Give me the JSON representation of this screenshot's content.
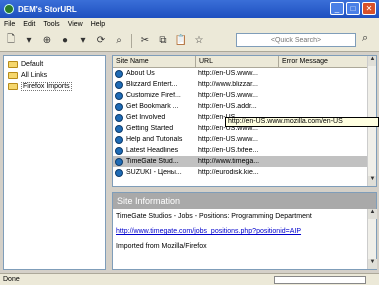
{
  "window": {
    "title": "DEM's StorURL"
  },
  "menubar": [
    "File",
    "Edit",
    "Tools",
    "View",
    "Help"
  ],
  "toolbar": {
    "quick_search_placeholder": "<Quick Search>"
  },
  "tree": {
    "items": [
      {
        "label": "Default",
        "selected": false
      },
      {
        "label": "All Links",
        "selected": false
      },
      {
        "label": "Firefox Imports",
        "selected": true
      }
    ]
  },
  "list": {
    "columns": [
      "Site Name",
      "URL",
      "Error Message"
    ],
    "rows": [
      {
        "name": "About Us",
        "url": "http://en-US.www..."
      },
      {
        "name": "Blizzard Entert...",
        "url": "http://www.blizzar..."
      },
      {
        "name": "Customize Firef...",
        "url": "http://en-US.www..."
      },
      {
        "name": "Get Bookmark ...",
        "url": "http://en-US.addr..."
      },
      {
        "name": "Get Involved",
        "url": "http://en-US."
      },
      {
        "name": "Getting Started",
        "url": "http://en-US.www..."
      },
      {
        "name": "Help and Tutorials",
        "url": "http://en-US.www..."
      },
      {
        "name": "Latest Headlines",
        "url": "http://en-US.fxfee..."
      },
      {
        "name": "TimeGate Stud...",
        "url": "http://www.timega..."
      },
      {
        "name": "SUZUKI - Цены...",
        "url": "http://eurodisk.kie..."
      }
    ],
    "selected_index": 8,
    "tooltip": "http://en-US.www.mozilla.com/en-US"
  },
  "site_info": {
    "header": "Site Information",
    "title": "TimeGate Studios - Jobs - Positions: Programming Department",
    "url": "http://www.timegate.com/jobs_positions.php?positionid=AIP",
    "note": "Imported from Mozilla/Firefox"
  },
  "status": {
    "text": "Done"
  }
}
